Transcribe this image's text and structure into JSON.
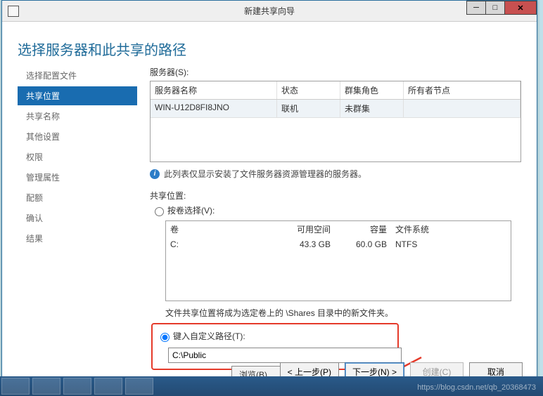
{
  "titlebar": {
    "title": "新建共享向导"
  },
  "header": {
    "title": "选择服务器和此共享的路径"
  },
  "nav": {
    "items": [
      {
        "label": "选择配置文件",
        "active": false
      },
      {
        "label": "共享位置",
        "active": true
      },
      {
        "label": "共享名称",
        "active": false
      },
      {
        "label": "其他设置",
        "active": false
      },
      {
        "label": "权限",
        "active": false
      },
      {
        "label": "管理属性",
        "active": false
      },
      {
        "label": "配额",
        "active": false
      },
      {
        "label": "确认",
        "active": false
      },
      {
        "label": "结果",
        "active": false
      }
    ]
  },
  "server": {
    "label": "服务器(S):",
    "columns": {
      "name": "服务器名称",
      "status": "状态",
      "role": "群集角色",
      "owner": "所有者节点"
    },
    "rows": [
      {
        "name": "WIN-U12D8FI8JNO",
        "status": "联机",
        "role": "未群集",
        "owner": ""
      }
    ],
    "info": "此列表仅显示安装了文件服务器资源管理器的服务器。"
  },
  "location": {
    "label": "共享位置:",
    "byVolume": {
      "label": "按卷选择(V):",
      "checked": false
    },
    "volTable": {
      "columns": {
        "vol": "卷",
        "free": "可用空间",
        "cap": "容量",
        "fs": "文件系统"
      },
      "rows": [
        {
          "vol": "C:",
          "free": "43.3 GB",
          "cap": "60.0 GB",
          "fs": "NTFS"
        }
      ]
    },
    "note": "文件共享位置将成为选定卷上的 \\Shares 目录中的新文件夹。",
    "custom": {
      "label": "键入自定义路径(T):",
      "checked": true,
      "value": "C:\\Public"
    },
    "browse": "浏览(B)..."
  },
  "buttons": {
    "prev": "< 上一步(P)",
    "next": "下一步(N) >",
    "create": "创建(C)",
    "cancel": "取消"
  },
  "watermark": "https://blog.csdn.net/qb_20368473"
}
